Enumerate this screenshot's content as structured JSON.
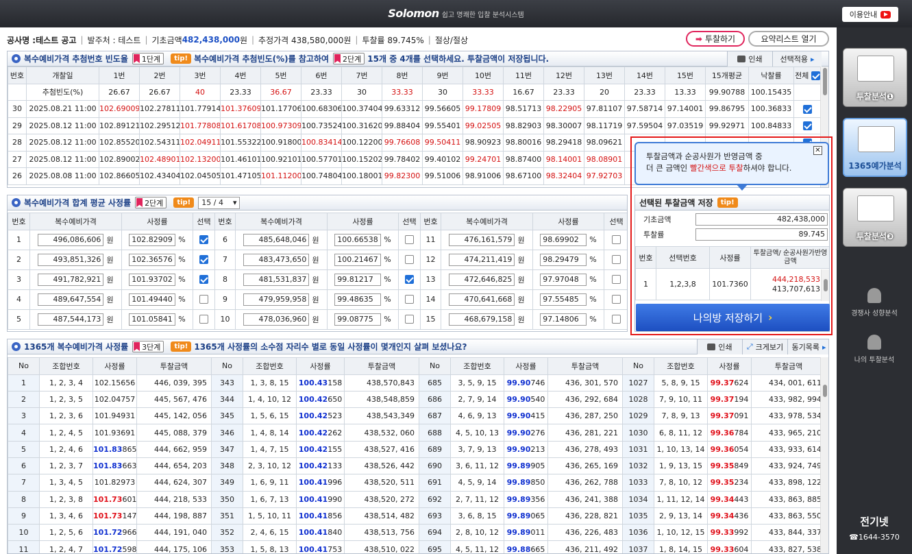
{
  "header": {
    "brand": "Solomon",
    "tagline": "쉽고 명쾌한 입찰 분석시스템",
    "help_label": "이용안내"
  },
  "info": {
    "project_label": "공사명 : ",
    "project_value": "테스트 공고",
    "client": "발주처 : 테스트",
    "base_label": "기초금액 ",
    "base_value": "482,438,000",
    "base_unit": "원",
    "estimate": "추정가격 438,580,000원",
    "rate": "투찰률 89.745%",
    "cut": "절상/절상",
    "bid_btn": "투찰하기",
    "summary_btn": "요약리스트 열기"
  },
  "sec1": {
    "title": "복수예비가격 추첨번호 빈도율",
    "step": "1단계",
    "tip": "tip!",
    "msg1": "복수예비가격 추첨빈도(%)를 참고하여",
    "step2": "2단계",
    "msg2": "15개 중 4개를 선택하세요. 투찰금액이 저장됩니다.",
    "print": "인쇄",
    "apply": "선택적용",
    "headers": [
      "번호",
      "개찰일",
      "1번",
      "2번",
      "3번",
      "4번",
      "5번",
      "6번",
      "7번",
      "8번",
      "9번",
      "10번",
      "11번",
      "12번",
      "13번",
      "14번",
      "15번",
      "15개평균",
      "낙찰률",
      "전체"
    ],
    "freq_label": "추첨빈도(%)",
    "freq": [
      "26.67",
      "26.67",
      "40",
      "23.33",
      "36.67",
      "23.33",
      "30",
      "33.33",
      "30",
      "33.33",
      "16.67",
      "23.33",
      "20",
      "23.33",
      "13.33",
      "99.90788",
      "100.15435"
    ],
    "rows": [
      {
        "no": "30",
        "date": "2025.08.21 11:00",
        "v": [
          "102.69009",
          "102.27811",
          "101.77914",
          "101.37609",
          "101.17706",
          "100.68306",
          "100.37404",
          "99.63312",
          "99.56605",
          "99.17809",
          "98.51713",
          "98.22905",
          "97.81107",
          "97.58714",
          "97.14001",
          "99.86795",
          "100.36833"
        ]
      },
      {
        "no": "29",
        "date": "2025.08.12 11:00",
        "v": [
          "102.89121",
          "102.29512",
          "101.77808",
          "101.61708",
          "100.97309",
          "100.73524",
          "100.31620",
          "99.88404",
          "99.55401",
          "99.02505",
          "98.82903",
          "98.30007",
          "98.11719",
          "97.59504",
          "97.03519",
          "99.92971",
          "100.84833"
        ]
      },
      {
        "no": "28",
        "date": "2025.08.12 11:00",
        "v": [
          "102.85520",
          "102.54311",
          "102.04911",
          "101.55322",
          "100.91800",
          "100.83414",
          "100.12200",
          "99.76608",
          "99.50411",
          "98.90923",
          "98.80016",
          "98.29418",
          "98.09621",
          "",
          ""
        ]
      },
      {
        "no": "27",
        "date": "2025.08.12 11:00",
        "v": [
          "102.89002",
          "102.48901",
          "102.13200",
          "101.46101",
          "100.92101",
          "100.57701",
          "100.15202",
          "99.78402",
          "99.40102",
          "99.24701",
          "98.87400",
          "98.14001",
          "98.08901",
          "",
          ""
        ]
      },
      {
        "no": "26",
        "date": "2025.08.08 11:00",
        "v": [
          "102.86605",
          "102.43404",
          "102.04505",
          "101.47105",
          "101.11200",
          "100.74804",
          "100.18001",
          "99.82300",
          "99.51006",
          "98.91006",
          "98.67100",
          "98.32404",
          "97.92703",
          "",
          ""
        ]
      }
    ]
  },
  "sec2": {
    "title": "복수예비가격 합계 평균 사정률",
    "step": "2단계",
    "tip": "tip!",
    "select_value": "15 / 4",
    "headers": [
      "번호",
      "복수예비가격",
      "사정률",
      "선택"
    ],
    "won": "원",
    "pct": "%",
    "rows": [
      [
        {
          "n": "1",
          "p": "496,086,606",
          "r": "102.82909",
          "c": true
        },
        {
          "n": "6",
          "p": "485,648,046",
          "r": "100.66538",
          "c": false
        },
        {
          "n": "11",
          "p": "476,161,579",
          "r": "98.69902",
          "c": false
        }
      ],
      [
        {
          "n": "2",
          "p": "493,851,326",
          "r": "102.36576",
          "c": true
        },
        {
          "n": "7",
          "p": "483,473,650",
          "r": "100.21467",
          "c": false
        },
        {
          "n": "12",
          "p": "474,211,419",
          "r": "98.29479",
          "c": false
        }
      ],
      [
        {
          "n": "3",
          "p": "491,782,921",
          "r": "101.93702",
          "c": true
        },
        {
          "n": "8",
          "p": "481,531,837",
          "r": "99.81217",
          "c": true
        },
        {
          "n": "13",
          "p": "472,646,825",
          "r": "97.97048",
          "c": false
        }
      ],
      [
        {
          "n": "4",
          "p": "489,647,554",
          "r": "101.49440",
          "c": false
        },
        {
          "n": "9",
          "p": "479,959,958",
          "r": "99.48635",
          "c": false
        },
        {
          "n": "14",
          "p": "470,641,668",
          "r": "97.55485",
          "c": false
        }
      ],
      [
        {
          "n": "5",
          "p": "487,544,173",
          "r": "101.05841",
          "c": false
        },
        {
          "n": "10",
          "p": "478,036,960",
          "r": "99.08775",
          "c": false
        },
        {
          "n": "15",
          "p": "468,679,158",
          "r": "97.14806",
          "c": false
        }
      ]
    ]
  },
  "popup": {
    "line1": "투찰금액과 순공사원가 반영금액 중",
    "line2a": "더 큰 금액인 ",
    "line2b": "빨간색으로 투찰",
    "line2c": "하셔야 합니다.",
    "close": "✕"
  },
  "save": {
    "title": "선택된 투찰금액 저장",
    "tip": "tip!",
    "base_label": "기초금액",
    "base_value": "482,438,000",
    "rate_label": "투찰률",
    "rate_value": "89.745",
    "headers": [
      "번호",
      "선택번호",
      "사정률",
      "투찰금액/ 순공사원가반영금액"
    ],
    "row": {
      "no": "1",
      "sel": "1,2,3,8",
      "rate": "101.7360",
      "amt1": "444,218,533",
      "amt2": "413,707,613"
    },
    "button": "나의방 저장하기"
  },
  "sec3": {
    "title": "1365개 복수예비가격 사정률",
    "step": "3단계",
    "tip": "tip!",
    "msg": "1365개 사정률의 소수점 자리수 별로 동일 사정률이 몇개인지 살펴 보셨나요?",
    "print": "인쇄",
    "zoom": "크게보기",
    "same": "동기목록",
    "headers": [
      "No",
      "조합번호",
      "사정률",
      "투찰금액"
    ],
    "rows": [
      [
        {
          "no": "1",
          "c": "1, 2, 3, 4",
          "h": "102.15656",
          "t": "",
          "a": "446, 039, 395"
        },
        {
          "no": "343",
          "c": "1, 3, 8, 15",
          "h": "100.43",
          "t": "158",
          "a": "438,570,843"
        },
        {
          "no": "685",
          "c": "3, 5, 9, 15",
          "h": "99.90",
          "t": "746",
          "a": "436, 301, 570"
        },
        {
          "no": "1027",
          "c": "5, 8, 9, 15",
          "h": "99.37",
          "t": "624",
          "a": "434, 001, 611"
        }
      ],
      [
        {
          "no": "2",
          "c": "1, 2, 3, 5",
          "h": "102.04757",
          "t": "",
          "a": "445, 567, 476"
        },
        {
          "no": "344",
          "c": "1, 4, 10, 12",
          "h": "100.42",
          "t": "650",
          "a": "438,548,859"
        },
        {
          "no": "686",
          "c": "2, 7, 9, 14",
          "h": "99.90",
          "t": "540",
          "a": "436, 292, 684"
        },
        {
          "no": "1028",
          "c": "7, 9, 10, 11",
          "h": "99.37",
          "t": "194",
          "a": "433, 982, 994"
        }
      ],
      [
        {
          "no": "3",
          "c": "1, 2, 3, 6",
          "h": "101.94931",
          "t": "",
          "a": "445, 142, 056"
        },
        {
          "no": "345",
          "c": "1, 5, 6, 15",
          "h": "100.42",
          "t": "523",
          "a": "438,543,349"
        },
        {
          "no": "687",
          "c": "4, 6, 9, 13",
          "h": "99.90",
          "t": "415",
          "a": "436, 287, 250"
        },
        {
          "no": "1029",
          "c": "7, 8, 9, 13",
          "h": "99.37",
          "t": "091",
          "a": "433, 978, 534"
        }
      ],
      [
        {
          "no": "4",
          "c": "1, 2, 4, 5",
          "h": "101.93691",
          "t": "",
          "a": "445, 088, 379"
        },
        {
          "no": "346",
          "c": "1, 4, 8, 14",
          "h": "100.42",
          "t": "262",
          "a": "438,532, 060"
        },
        {
          "no": "688",
          "c": "4, 5, 10, 13",
          "h": "99.90",
          "t": "276",
          "a": "436, 281, 221"
        },
        {
          "no": "1030",
          "c": "6, 8, 11, 12",
          "h": "99.36",
          "t": "784",
          "a": "433, 965, 210"
        }
      ],
      [
        {
          "no": "5",
          "c": "1, 2, 4, 6",
          "h": "101.83",
          "t": "865",
          "a": "444, 662, 959"
        },
        {
          "no": "347",
          "c": "1, 4, 7, 15",
          "h": "100.42",
          "t": "155",
          "a": "438,527, 416"
        },
        {
          "no": "689",
          "c": "3, 7, 9, 13",
          "h": "99.90",
          "t": "213",
          "a": "436, 278, 493"
        },
        {
          "no": "1031",
          "c": "1, 10, 13, 14",
          "h": "99.36",
          "t": "054",
          "a": "433, 933, 614"
        }
      ],
      [
        {
          "no": "6",
          "c": "1, 2, 3, 7",
          "h": "101.83",
          "t": "663",
          "a": "444, 654, 203"
        },
        {
          "no": "348",
          "c": "2, 3, 10, 12",
          "h": "100.42",
          "t": "133",
          "a": "438,526, 442"
        },
        {
          "no": "690",
          "c": "3, 6, 11, 12",
          "h": "99.89",
          "t": "905",
          "a": "436, 265, 169"
        },
        {
          "no": "1032",
          "c": "1, 9, 13, 15",
          "h": "99.35",
          "t": "849",
          "a": "433, 924, 749"
        }
      ],
      [
        {
          "no": "7",
          "c": "1, 3, 4, 5",
          "h": "101.82973",
          "t": "",
          "a": "444, 624, 307"
        },
        {
          "no": "349",
          "c": "1, 6, 9, 11",
          "h": "100.41",
          "t": "996",
          "a": "438,520, 511"
        },
        {
          "no": "691",
          "c": "4, 5, 9, 14",
          "h": "99.89",
          "t": "850",
          "a": "436, 262, 788"
        },
        {
          "no": "1033",
          "c": "7, 8, 10, 12",
          "h": "99.35",
          "t": "234",
          "a": "433, 898, 122"
        }
      ],
      [
        {
          "no": "8",
          "c": "1, 2, 3, 8",
          "h": "101.73",
          "t": "601",
          "a": "444, 218, 533"
        },
        {
          "no": "350",
          "c": "1, 6, 7, 13",
          "h": "100.41",
          "t": "990",
          "a": "438,520, 272"
        },
        {
          "no": "692",
          "c": "2, 7, 11, 12",
          "h": "99.89",
          "t": "356",
          "a": "436, 241, 388"
        },
        {
          "no": "1034",
          "c": "1, 11, 12, 14",
          "h": "99.34",
          "t": "443",
          "a": "433, 863, 885"
        }
      ],
      [
        {
          "no": "9",
          "c": "1, 3, 4, 6",
          "h": "101.73",
          "t": "147",
          "a": "444, 198, 887"
        },
        {
          "no": "351",
          "c": "1, 5, 10, 11",
          "h": "100.41",
          "t": "856",
          "a": "438,514, 482"
        },
        {
          "no": "693",
          "c": "3, 6, 8, 15",
          "h": "99.89",
          "t": "065",
          "a": "436, 228, 821"
        },
        {
          "no": "1035",
          "c": "2, 9, 13, 14",
          "h": "99.34",
          "t": "436",
          "a": "433, 863, 550"
        }
      ],
      [
        {
          "no": "10",
          "c": "1, 2, 5, 6",
          "h": "101.72",
          "t": "966",
          "a": "444, 191, 040"
        },
        {
          "no": "352",
          "c": "2, 4, 6, 15",
          "h": "100.41",
          "t": "840",
          "a": "438,513, 756"
        },
        {
          "no": "694",
          "c": "2, 8, 10, 12",
          "h": "99.89",
          "t": "011",
          "a": "436, 226, 483"
        },
        {
          "no": "1036",
          "c": "1, 10, 12, 15",
          "h": "99.33",
          "t": "992",
          "a": "433, 844, 337"
        }
      ],
      [
        {
          "no": "11",
          "c": "1, 2, 4, 7",
          "h": "101.72",
          "t": "598",
          "a": "444, 175, 106"
        },
        {
          "no": "353",
          "c": "1, 5, 8, 13",
          "h": "100.41",
          "t": "753",
          "a": "438,510, 022"
        },
        {
          "no": "695",
          "c": "4, 5, 11, 12",
          "h": "99.88",
          "t": "665",
          "a": "436, 211, 492"
        },
        {
          "no": "1037",
          "c": "1, 8, 14, 15",
          "h": "99.33",
          "t": "604",
          "a": "433, 827, 538"
        }
      ]
    ]
  },
  "sidebar": {
    "tile1": "투찰분석❶",
    "tile2": "1365예가분석",
    "tile3": "투찰분석❸",
    "item1": "경쟁사 성향분석",
    "item2": "나의 투찰분석",
    "logo": "전기넷",
    "phone": "☎1644-3570"
  }
}
